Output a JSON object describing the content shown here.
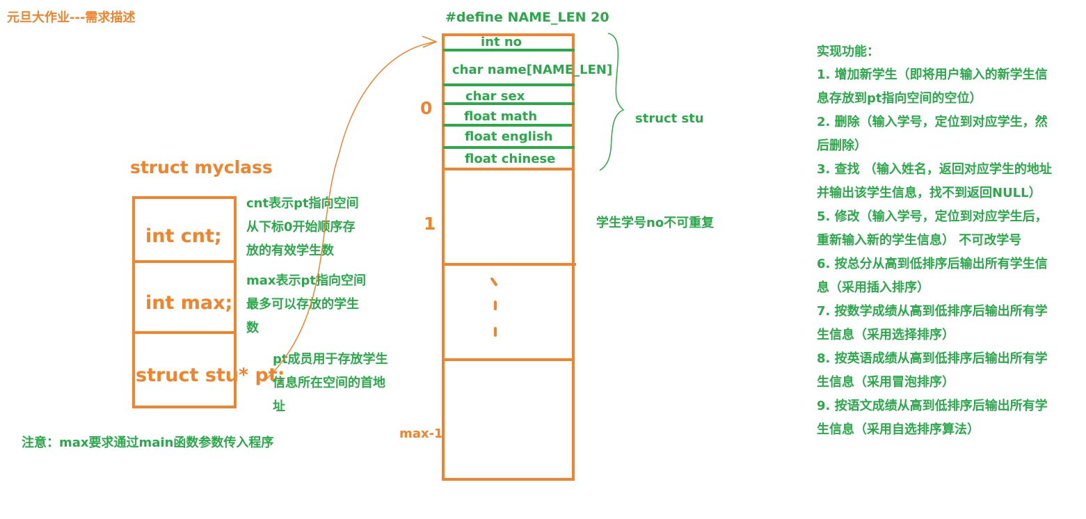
{
  "title": "元旦大作业---需求描述",
  "define": "#define NAME_LEN 20",
  "myclass": {
    "label": "struct myclass",
    "cells": [
      "int cnt;",
      "int max;",
      "struct stu* pt;"
    ],
    "notes": [
      [
        "cnt表示pt指向空间",
        "从下标0开始顺序存",
        "放的有效学生数"
      ],
      [
        "max表示pt指向空间",
        "最多可以存放的学生",
        "数"
      ],
      [
        "pt成员用于存放学生",
        "信息所在空间的首地",
        "址"
      ]
    ]
  },
  "stu": {
    "label": "struct stu",
    "fields": [
      "int no",
      "char name[NAME_LEN]",
      "char sex",
      "float math",
      "float english",
      "float chinese"
    ]
  },
  "indices": [
    "0",
    "1",
    "max-1"
  ],
  "unique_note": "学生学号no不可重复",
  "main_note": "注意：max要求通过main函数参数传入程序",
  "features": {
    "heading": "实现功能：",
    "lines": [
      "1. 增加新学生（即将用户输入的新学生信",
      "息存放到pt指向空间的空位）",
      "2. 删除（输入学号，定位到对应学生，然",
      "后删除）",
      "3. 查找 （输入姓名，返回对应学生的地址",
      "并输出该学生信息，找不到返回NULL）",
      "5. 修改（输入学号，定位到对应学生后，",
      "重新输入新的学生信息） 不可改学号",
      "6. 按总分从高到低排序后输出所有学生信",
      "息（采用插入排序）",
      "7. 按数学成绩从高到低排序后输出所有学",
      "生信息（采用选择排序）",
      "8. 按英语成绩从高到低排序后输出所有学",
      "生信息（采用冒泡排序）",
      "9. 按语文成绩从高到低排序后输出所有学",
      "生信息（采用自选排序算法）"
    ]
  },
  "colors": {
    "orange": "#f0832b",
    "green": "#2aa84a"
  }
}
